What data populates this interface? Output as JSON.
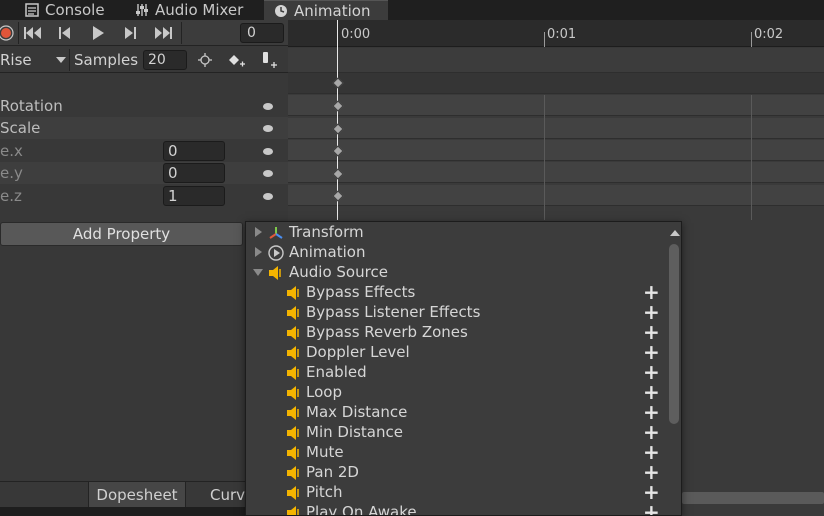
{
  "tabs": [
    {
      "label": "Console",
      "icon": "console-icon"
    },
    {
      "label": "Audio Mixer",
      "icon": "audio-mixer-icon"
    },
    {
      "label": "Animation",
      "icon": "animation-clock-icon",
      "active": true
    }
  ],
  "toolbar": {
    "frame_value": "0",
    "buttons": [
      "record-icon",
      "first-key-icon",
      "prev-key-icon",
      "play-icon",
      "next-key-icon",
      "last-key-icon"
    ]
  },
  "clipbar": {
    "clip_name": "Rise",
    "samples_label": "Samples",
    "samples_value": "20"
  },
  "properties": [
    {
      "label": "Rotation",
      "value": null
    },
    {
      "label": "Scale",
      "value": null
    },
    {
      "label": "e.x",
      "value": "0"
    },
    {
      "label": "e.y",
      "value": "0"
    },
    {
      "label": "e.z",
      "value": "1"
    }
  ],
  "add_property_label": "Add Property",
  "bottom_tabs": {
    "dopesheet": "Dopesheet",
    "curves": "Curv"
  },
  "timeline": {
    "ticks": [
      "0:00",
      "0:01",
      "0:02"
    ]
  },
  "popup": {
    "categories": [
      {
        "label": "Transform",
        "expanded": false,
        "icon": "transform-icon"
      },
      {
        "label": "Animation",
        "expanded": false,
        "icon": "animation-icon"
      },
      {
        "label": "Audio Source",
        "expanded": true,
        "icon": "audio-source-icon"
      }
    ],
    "items": [
      "Bypass Effects",
      "Bypass Listener Effects",
      "Bypass Reverb Zones",
      "Doppler Level",
      "Enabled",
      "Loop",
      "Max Distance",
      "Min Distance",
      "Mute",
      "Pan 2D",
      "Pitch",
      "Play On Awake"
    ],
    "add_symbol": "+"
  },
  "colors": {
    "accent_record": "#e0553a",
    "speaker": "#f4b400",
    "playhead": "#e8e8e8"
  }
}
